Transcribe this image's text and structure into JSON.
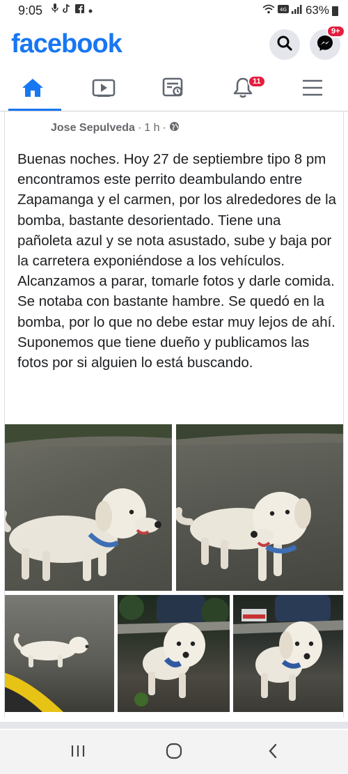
{
  "status_bar": {
    "time": "9:05",
    "battery": "63%",
    "icons_left": [
      "mic-icon",
      "tiktok-icon",
      "facebook-small-icon",
      "dot-icon"
    ],
    "icons_right": [
      "wifi-icon",
      "volte-icon",
      "signal-icon",
      "battery-icon"
    ]
  },
  "header": {
    "logo": "facebook",
    "messenger_badge": "9+"
  },
  "tabs": [
    {
      "icon": "home-icon",
      "active": true
    },
    {
      "icon": "watch-icon",
      "active": false
    },
    {
      "icon": "marketplace-icon",
      "active": false
    },
    {
      "icon": "notifications-icon",
      "active": false,
      "badge": "11"
    },
    {
      "icon": "menu-icon",
      "active": false
    }
  ],
  "post": {
    "author": "Jose Sepulveda",
    "separator": "·",
    "time": "1 h",
    "privacy_icon": "globe-icon",
    "text": "Buenas noches. Hoy 27 de septiembre tipo 8 pm encontramos este perrito deambulando entre Zapamanga y el carmen, por los alrededores de la bomba, bastante desorientado. Tiene una pañoleta azul y se nota asustado, sube y baja por la carretera exponiéndose a los vehículos. Alcanzamos a parar, tomarle fotos y darle comida. Se notaba con bastante hambre. Se quedó en la bomba, por lo que no debe estar muy lejos de ahí. Suponemos que tiene dueño y publicamos las fotos por si alguien lo está buscando.",
    "photos": [
      "dog-photo-1",
      "dog-photo-2",
      "dog-photo-3",
      "dog-photo-4",
      "dog-photo-5"
    ]
  },
  "accent_color": "#1877f2",
  "badge_color": "#e41e3f",
  "nav_bar": [
    "recent-apps-icon",
    "home-circle-icon",
    "back-icon"
  ]
}
